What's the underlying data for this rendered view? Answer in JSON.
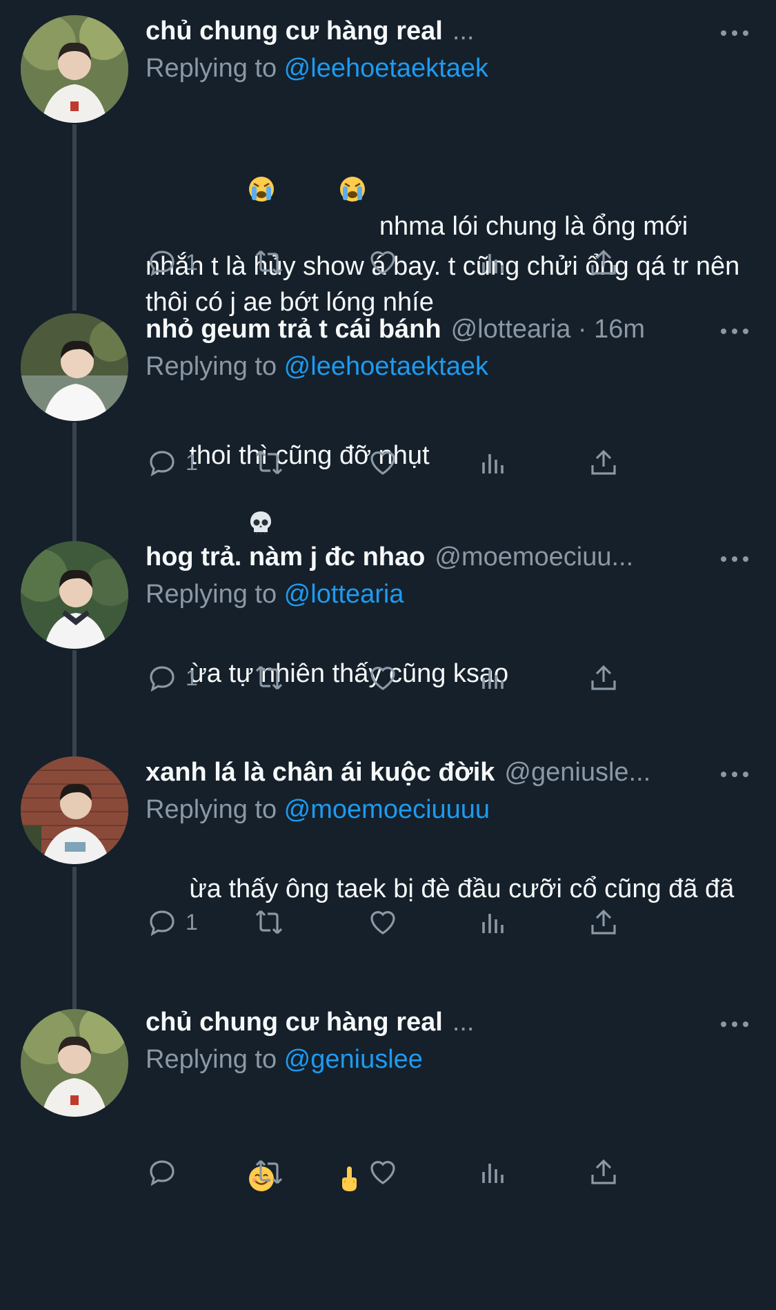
{
  "tweets": [
    {
      "name": "chủ chung cư hàng real",
      "handle": "...",
      "replying_label": "Replying to ",
      "replying_to": "@leehoetaektaek",
      "text": "nhma lói chung là ổng mới nhắn t là hủy show á bay. t cũng chửi ổng qá tr nên thôi có j ae bớt lóng nhíe",
      "leading_emojis": [
        "loudly-crying-face",
        "loudly-crying-face"
      ],
      "reply_count": "1",
      "avatar_bg": "#6b7c4f"
    },
    {
      "name": "nhỏ geum trả t cái bánh",
      "handle": "@lottearia · 16m",
      "replying_label": "Replying to ",
      "replying_to": "@leehoetaektaek",
      "text": "thoi thì cũng đỡ nhụt",
      "trailing_emojis": [
        "skull"
      ],
      "reply_count": "1",
      "avatar_bg": "#4d5a3b"
    },
    {
      "name": "hog trả. nàm j đc nhao",
      "handle": "@moemoeciuu...",
      "replying_label": "Replying to ",
      "replying_to": "@lottearia",
      "text": "ừa tự nhiên thấy cũng ksao",
      "reply_count": "1",
      "avatar_bg": "#3f5a3a"
    },
    {
      "name": "xanh lá là chân ái kuộc đờik",
      "handle": "@geniusle...",
      "replying_label": "Replying to ",
      "replying_to": "@moemoeciuuuu",
      "text": "ừa thấy ông taek bị đè đầu cưỡi cổ cũng đã đã",
      "reply_count": "1",
      "avatar_bg": "#8a4a3a"
    },
    {
      "name": "chủ chung cư hàng real",
      "handle": "...",
      "replying_label": "Replying to ",
      "replying_to": "@geniuslee",
      "text": "",
      "leading_emojis": [
        "smiling-face",
        "middle-finger"
      ],
      "reply_count": "",
      "avatar_bg": "#6b7c4f"
    }
  ],
  "colors": {
    "background": "#15202b",
    "mention": "#1d9bf0",
    "muted": "#8b98a5",
    "thread_line": "#38444d"
  },
  "icons": [
    "reply-icon",
    "retweet-icon",
    "like-icon",
    "views-icon",
    "share-icon",
    "more-icon"
  ]
}
